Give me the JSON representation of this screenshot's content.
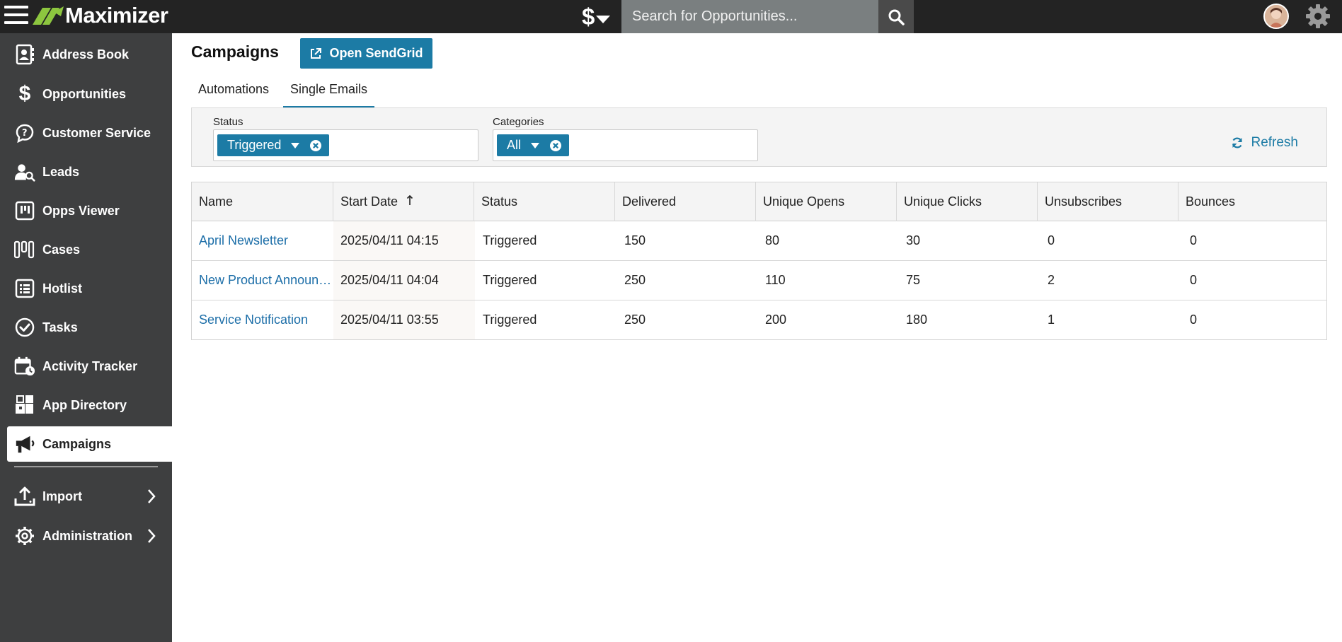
{
  "app": {
    "name": "Maximizer"
  },
  "topbar": {
    "module_symbol": "$",
    "search_placeholder": "Search for Opportunities..."
  },
  "sidebar": {
    "items": [
      {
        "label": "Address Book",
        "icon": "address-book-icon"
      },
      {
        "label": "Opportunities",
        "icon": "dollar-icon"
      },
      {
        "label": "Customer Service",
        "icon": "customer-service-icon"
      },
      {
        "label": "Leads",
        "icon": "leads-icon"
      },
      {
        "label": "Opps Viewer",
        "icon": "opps-viewer-icon"
      },
      {
        "label": "Cases",
        "icon": "cases-icon"
      },
      {
        "label": "Hotlist",
        "icon": "hotlist-icon"
      },
      {
        "label": "Tasks",
        "icon": "tasks-icon"
      },
      {
        "label": "Activity Tracker",
        "icon": "activity-tracker-icon"
      },
      {
        "label": "App Directory",
        "icon": "app-directory-icon"
      },
      {
        "label": "Campaigns",
        "icon": "megaphone-icon",
        "active": true
      }
    ],
    "lower_items": [
      {
        "label": "Import",
        "icon": "upload-icon"
      },
      {
        "label": "Administration",
        "icon": "gear-icon"
      }
    ]
  },
  "main": {
    "title": "Campaigns",
    "open_sendgrid_label": "Open SendGrid",
    "tabs": [
      {
        "label": "Automations",
        "active": false
      },
      {
        "label": "Single Emails",
        "active": true
      }
    ],
    "filters": {
      "status_label": "Status",
      "status_value": "Triggered",
      "categories_label": "Categories",
      "categories_value": "All",
      "refresh_label": "Refresh"
    },
    "table": {
      "columns": [
        "Name",
        "Start Date",
        "Status",
        "Delivered",
        "Unique Opens",
        "Unique Clicks",
        "Unsubscribes",
        "Bounces"
      ],
      "sort_column": "Start Date",
      "rows": [
        {
          "name": "April Newsletter",
          "start_date": "2025/04/11 04:15",
          "status": "Triggered",
          "delivered": "150",
          "unique_opens": "80",
          "unique_clicks": "30",
          "unsubscribes": "0",
          "bounces": "0"
        },
        {
          "name": "New Product Announcement",
          "start_date": "2025/04/11 04:04",
          "status": "Triggered",
          "delivered": "250",
          "unique_opens": "110",
          "unique_clicks": "75",
          "unsubscribes": "2",
          "bounces": "0"
        },
        {
          "name": "Service Notification",
          "start_date": "2025/04/11 03:55",
          "status": "Triggered",
          "delivered": "250",
          "unique_opens": "200",
          "unique_clicks": "180",
          "unsubscribes": "1",
          "bounces": "0"
        }
      ]
    }
  },
  "colors": {
    "topbar": "#232323",
    "sidebar": "#3e3f40",
    "accent": "#1c7ba5",
    "logo_green": "#8dc63f",
    "link": "#1c6ea8"
  }
}
